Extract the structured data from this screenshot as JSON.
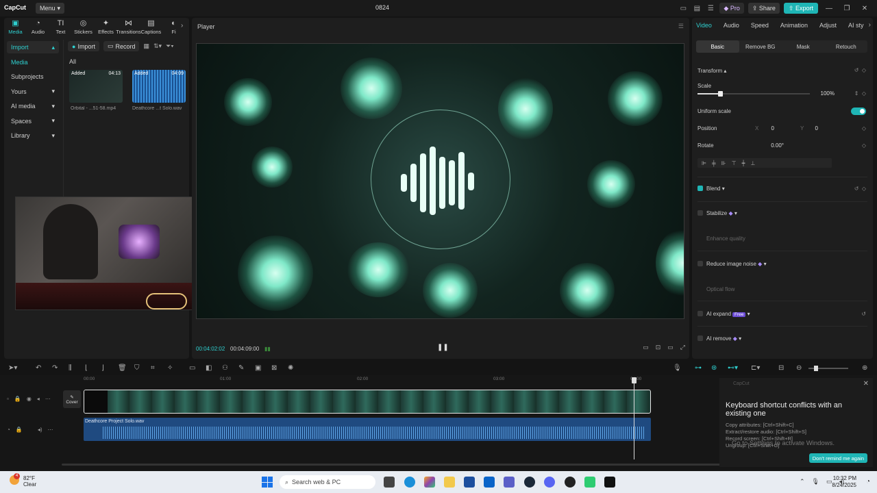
{
  "app": {
    "logo": "CapCut",
    "menu_label": "Menu",
    "project_title": "0824"
  },
  "titlebar": {
    "pro_label": "Pro",
    "share_label": "Share",
    "export_label": "Export"
  },
  "tools": [
    {
      "label": "Media",
      "glyph": "▣"
    },
    {
      "label": "Audio",
      "glyph": "◔"
    },
    {
      "label": "Text",
      "glyph": "TI"
    },
    {
      "label": "Stickers",
      "glyph": "◎"
    },
    {
      "label": "Effects",
      "glyph": "✦"
    },
    {
      "label": "Transitions",
      "glyph": "⋈"
    },
    {
      "label": "Captions",
      "glyph": "▤"
    },
    {
      "label": "Fi",
      "glyph": "◐"
    }
  ],
  "sidebar": {
    "import": "Import",
    "media": "Media",
    "subprojects": "Subprojects",
    "yours": "Yours",
    "ai_media": "AI media",
    "spaces": "Spaces",
    "library": "Library"
  },
  "media_panel": {
    "import_btn": "Import",
    "record_btn": "Record",
    "all_label": "All",
    "items": [
      {
        "tag": "Added",
        "duration": "04:13",
        "name": "Orbital - ...51-58.mp4"
      },
      {
        "tag": "Added",
        "duration": "04:09",
        "name": "Deathcore ...t Solo.wav"
      }
    ]
  },
  "player": {
    "label": "Player",
    "current_time": "00:04:02:02",
    "total_time": "00:04:09:00",
    "pause_glyph": "❚❚"
  },
  "right_panel": {
    "tabs": [
      "Video",
      "Audio",
      "Speed",
      "Animation",
      "Adjust",
      "AI sty"
    ],
    "subtabs": [
      "Basic",
      "Remove BG",
      "Mask",
      "Retouch"
    ],
    "transform_label": "Transform",
    "scale_label": "Scale",
    "scale_value": "100%",
    "scale_fraction": 0.21,
    "uniform_scale_label": "Uniform scale",
    "position_label": "Position",
    "pos_x_label": "X",
    "pos_x": "0",
    "pos_y_label": "Y",
    "pos_y": "0",
    "rotate_label": "Rotate",
    "rotate_value": "0.00°",
    "blend_label": "Blend",
    "stabilize_label": "Stabilize",
    "enhance_label": "Enhance quality",
    "reduce_noise_label": "Reduce image noise",
    "optical_flow_label": "Optical flow",
    "ai_expand_label": "AI expand",
    "free_badge": "Free",
    "ai_remove_label": "AI remove"
  },
  "timeline": {
    "ruler": [
      "00:00",
      "01:00",
      "02:00",
      "03:00",
      "04:00"
    ],
    "cover_label": "Cover",
    "audio_clip_name": "Deathcore Project Solo.wav"
  },
  "notification": {
    "header": "CapCut",
    "title": "Keyboard shortcut conflicts with an existing one",
    "lines": [
      "Copy attributes: [Ctrl+Shift+C]",
      "Extract/restore audio: [Ctrl+Shift+S]",
      "Record screen: [Ctrl+Shift+R]",
      "Ungroup: [Ctrl+Shift+G]"
    ],
    "dont_remind": "Don't remind me again"
  },
  "watermark": {
    "activate": "Go to Settings to activate Windows."
  },
  "taskbar": {
    "temp": "82°F",
    "weather": "Clear",
    "search_placeholder": "Search web & PC",
    "time": "10:32 PM",
    "date": "8/24/2025",
    "notification_count": "4"
  },
  "colors": {
    "accent": "#1fb5b5",
    "pro": "#d9b8ff",
    "audio_track": "#1f4a80"
  }
}
